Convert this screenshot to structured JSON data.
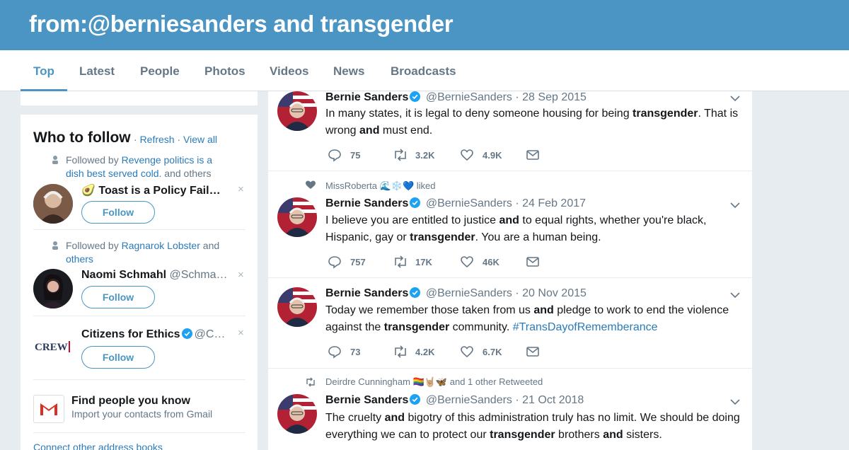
{
  "header": {
    "query": "from:@berniesanders and transgender"
  },
  "nav": {
    "tabs": [
      {
        "label": "Top"
      },
      {
        "label": "Latest"
      },
      {
        "label": "People"
      },
      {
        "label": "Photos"
      },
      {
        "label": "Videos"
      },
      {
        "label": "News"
      },
      {
        "label": "Broadcasts"
      }
    ],
    "active": "Top"
  },
  "who_to_follow": {
    "title": "Who to follow",
    "refresh_label": "Refresh",
    "view_all_label": "View all",
    "follow_label": "Follow",
    "dismiss_glyph": "×",
    "suggestions": [
      {
        "social_prefix": "Followed by",
        "social_link": "Revenge politics is a dish best served cold.",
        "social_suffix": "and others",
        "name": "🥑 Toast is a Policy Fail…",
        "handle": ""
      },
      {
        "social_prefix": "Followed by",
        "social_link": "Ragnarok Lobster",
        "social_suffix": "and",
        "social_link2": "others",
        "name": "Naomi Schmahl",
        "handle": "@Schma…"
      },
      {
        "name": "Citizens for Ethics",
        "handle": "@C…",
        "logo_text": "CREW"
      }
    ],
    "find_people_title": "Find people you know",
    "find_people_sub": "Import your contacts from Gmail",
    "connect_label": "Connect other address books"
  },
  "tweets": [
    {
      "name": "Bernie Sanders",
      "handle": "@BernieSanders",
      "date": "28 Sep 2015",
      "text_html": "In many states, it is legal to deny someone housing for being <b>transgender</b>. That is wrong <b>and</b> must end.",
      "replies": "75",
      "retweets": "3.2K",
      "likes": "4.9K"
    },
    {
      "context_user": "MissRoberta 🌊❄️💙",
      "context_action": "liked",
      "name": "Bernie Sanders",
      "handle": "@BernieSanders",
      "date": "24 Feb 2017",
      "text_html": "I believe you are entitled to justice <b>and</b> to equal rights, whether you're black, Hispanic, gay or <b>transgender</b>. You are a human being.",
      "replies": "757",
      "retweets": "17K",
      "likes": "46K"
    },
    {
      "name": "Bernie Sanders",
      "handle": "@BernieSanders",
      "date": "20 Nov 2015",
      "text_html": "Today we remember those taken from us <b>and</b> pledge to work to end the violence against the <b>transgender</b> community. <span class=\"link\">#TransDayofRememberance</span>",
      "replies": "73",
      "retweets": "4.2K",
      "likes": "6.7K"
    },
    {
      "context_user": "Deirdre Cunningham 🏳️‍🌈🤘🏼🦋",
      "context_action": "and 1 other Retweeted",
      "name": "Bernie Sanders",
      "handle": "@BernieSanders",
      "date": "21 Oct 2018",
      "text_html": "The cruelty <b>and</b> bigotry of this administration truly has no limit. We should be doing everything we can to protect our <b>transgender</b> brothers <b>and</b> sisters."
    }
  ],
  "colors": {
    "header_blue": "#4a95c3",
    "link_blue": "#2b7bb9",
    "muted": "#657786",
    "background": "#e6ecf0"
  }
}
